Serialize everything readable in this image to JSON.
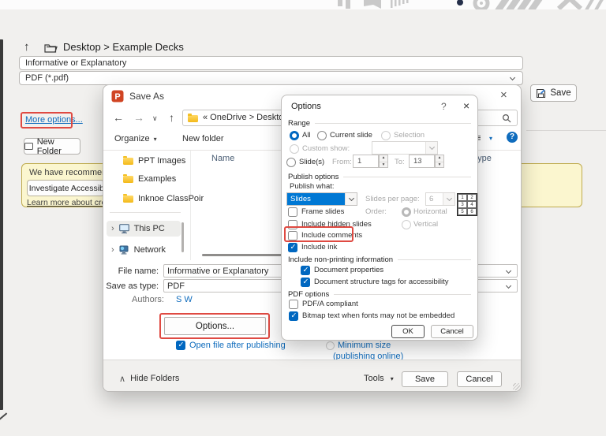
{
  "colors": {
    "accent_blue": "#0067c0",
    "selection_blue": "#0078d4",
    "annotation_red": "#df4a42",
    "folder_yellow": "#f3b919",
    "link_blue": "#0f6cbd",
    "banner_yellow_bg": "#fbf6cf",
    "banner_yellow_border": "#bfab4e"
  },
  "icons": {
    "up_arrow": "↑",
    "back_arrow": "←",
    "forward_arrow": "→",
    "small_down_chevron": "∨",
    "collapse_caret": "∧",
    "dropdown_caret": "▾",
    "view_list": "≡",
    "close": "×",
    "help": "?",
    "question": "?",
    "expander": "›",
    "spin_up": "▴",
    "spin_down": "▾"
  },
  "top_bar": {
    "breadcrumb_path": "Desktop > Example Decks"
  },
  "export_pane": {
    "filename_value": "Informative or Explanatory",
    "filetype_value": "PDF (*.pdf)",
    "more_options": "More options...",
    "new_folder": "New Folder",
    "save": "Save",
    "recommendation_text": "We have recommendation",
    "recommendation_action": "Investigate Accessibi",
    "recommendation_link": "Learn more about creating"
  },
  "save_as": {
    "title": "Save As",
    "address": "« OneDrive > Desktop >",
    "organize": "Organize",
    "new_folder": "New folder",
    "col_name": "Name",
    "col_type": "Type",
    "sidebar": [
      {
        "label": "PPT Images"
      },
      {
        "label": "Examples"
      },
      {
        "label": "Inknoe ClassPoir"
      },
      {
        "label": "This PC"
      },
      {
        "label": "Network"
      }
    ],
    "file_name_label": "File name:",
    "file_name_value": "Informative or Explanatory",
    "type_label": "Save as type:",
    "type_value": "PDF",
    "authors_label": "Authors:",
    "authors_value": "S W",
    "options_button": "Options...",
    "open_after": "Open file after publishing",
    "min_size": "Minimum size",
    "pub_online": "(publishing online)",
    "hide_folders": "Hide Folders",
    "tools": "Tools",
    "save": "Save",
    "cancel": "Cancel"
  },
  "options": {
    "title": "Options",
    "range": {
      "group": "Range",
      "all": "All",
      "current": "Current slide",
      "selection": "Selection",
      "custom_show": "Custom show:",
      "slides": "Slide(s)",
      "from": "From:",
      "from_value": "1",
      "to": "To:",
      "to_value": "13"
    },
    "publish": {
      "group": "Publish options",
      "publish_what": "Publish what:",
      "publish_what_value": "Slides",
      "per_page": "Slides per page:",
      "per_page_value": "6",
      "order": "Order:",
      "horizontal": "Horizontal",
      "vertical": "Vertical",
      "frame": "Frame slides",
      "hidden": "Include hidden slides",
      "comments": "Include comments",
      "ink": "Include ink",
      "grid": [
        "1",
        "2",
        "3",
        "4",
        "5",
        "6"
      ]
    },
    "nonprinting": {
      "group": "Include non-printing information",
      "props": "Document properties",
      "tags": "Document structure tags for accessibility"
    },
    "pdf": {
      "group": "PDF options",
      "pdfa": "PDF/A compliant",
      "bitmap": "Bitmap text when fonts may not be embedded"
    },
    "ok": "OK",
    "cancel": "Cancel"
  }
}
